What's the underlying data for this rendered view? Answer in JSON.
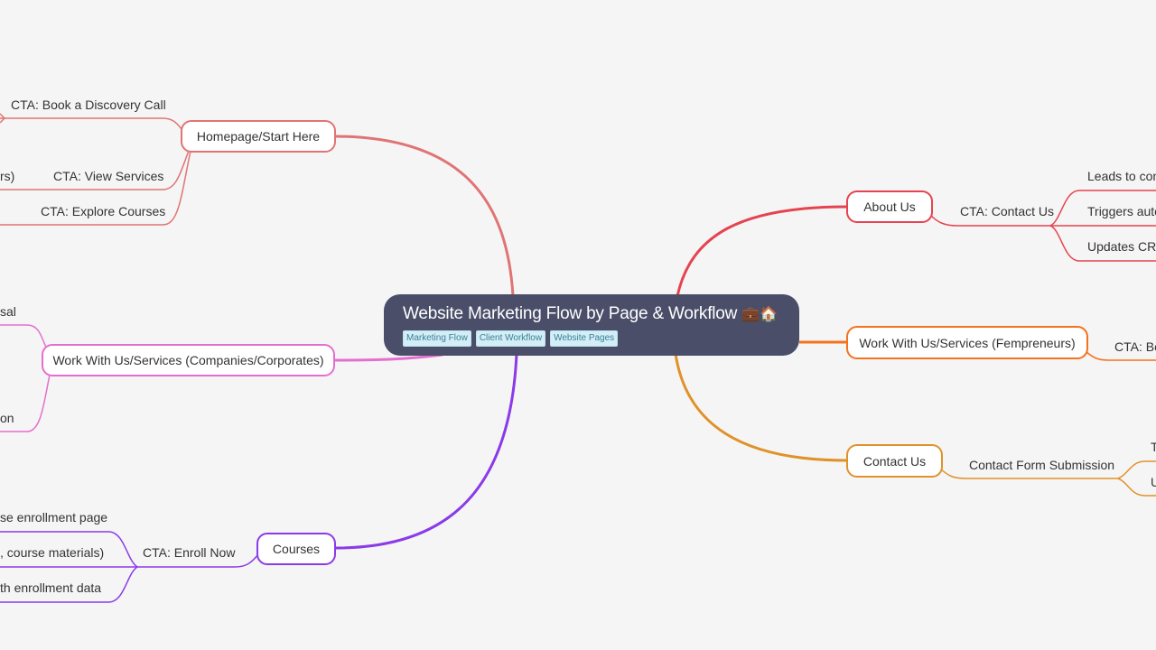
{
  "root": {
    "title": "Website Marketing Flow by Page & Workflow",
    "emoji": "💼🏠",
    "tags": [
      "Marketing Flow",
      "Client Workflow",
      "Website Pages"
    ],
    "background": "#4a4e69"
  },
  "branches": [
    {
      "id": "homepage",
      "label": "Homepage/Start Here",
      "color": "#e07474",
      "children": [
        {
          "label": "CTA: Book a Discovery Call"
        },
        {
          "label": "CTA: View Services",
          "partial_sibling": "rs)"
        },
        {
          "label": "CTA: Explore Courses"
        }
      ]
    },
    {
      "id": "work-corporates",
      "label": "Work With Us/Services (Companies/Corporates)",
      "color": "#e46fd0",
      "children": [
        {
          "label": "sal"
        },
        {
          "label": "on"
        }
      ]
    },
    {
      "id": "courses",
      "label": "Courses",
      "color": "#8a3be8",
      "children": [
        {
          "label": "CTA: Enroll Now",
          "children": [
            {
              "label": "se enrollment page"
            },
            {
              "label": ", course materials)"
            },
            {
              "label": "th enrollment data"
            }
          ]
        }
      ]
    },
    {
      "id": "about",
      "label": "About Us",
      "color": "#e5434f",
      "children": [
        {
          "label": "CTA: Contact Us",
          "children": [
            {
              "label": "Leads to con"
            },
            {
              "label": "Triggers auto"
            },
            {
              "label": "Updates CRM"
            }
          ]
        }
      ]
    },
    {
      "id": "work-fempreneurs",
      "label": "Work With Us/Services (Fempreneurs)",
      "color": "#f4721e",
      "children": [
        {
          "label": "CTA: Bo"
        }
      ]
    },
    {
      "id": "contact",
      "label": "Contact Us",
      "color": "#e0922a",
      "children": [
        {
          "label": "Contact Form Submission",
          "children": [
            {
              "label": "T"
            },
            {
              "label": "U"
            }
          ]
        }
      ]
    }
  ]
}
